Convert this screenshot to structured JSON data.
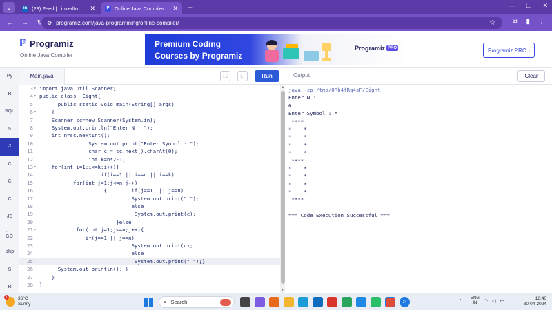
{
  "browser": {
    "tabs": [
      {
        "label": "(23) Feed | LinkedIn",
        "favicon": "in"
      },
      {
        "label": "Online Java Compiler",
        "favicon": "P"
      }
    ],
    "url": "programiz.com/java-programming/online-compiler/"
  },
  "site": {
    "brand": "Programiz",
    "subtitle": "Online Java Compiler",
    "banner": {
      "line1": "Premium Coding",
      "line2": "Courses by Programiz",
      "brand": "Programiz",
      "brand_badge": "PRO"
    },
    "pro_button": "Programiz PRO ›"
  },
  "sidebar": {
    "items": [
      {
        "label": "Py",
        "icon": "python-icon"
      },
      {
        "label": "R",
        "icon": "r-icon"
      },
      {
        "label": "SQL",
        "icon": "database-icon"
      },
      {
        "label": "5",
        "icon": "html-icon"
      },
      {
        "label": "J",
        "icon": "java-icon"
      },
      {
        "label": "C",
        "icon": "c-icon"
      },
      {
        "label": "C",
        "icon": "cpp-icon"
      },
      {
        "label": "C",
        "icon": "csharp-icon"
      },
      {
        "label": "JS",
        "icon": "javascript-icon"
      },
      {
        "label": "-GO",
        "icon": "go-icon"
      },
      {
        "label": "php",
        "icon": "php-icon"
      },
      {
        "label": "S",
        "icon": "swift-icon"
      },
      {
        "label": "R",
        "icon": "rust-icon"
      }
    ],
    "active_index": 4
  },
  "editor": {
    "filename": "Main.java",
    "run_label": "Run",
    "current_line": 25,
    "lines": [
      {
        "n": "3",
        "fold": "▾",
        "code": "import java.util.Scanner;"
      },
      {
        "n": "4",
        "fold": "▾",
        "code": "public class  Eight{"
      },
      {
        "n": "5",
        "fold": "",
        "code": "      public static void main(String[] args)"
      },
      {
        "n": "6",
        "fold": "▾",
        "code": "    {"
      },
      {
        "n": "7",
        "fold": "",
        "code": "    Scanner sc=new Scanner(System.in);"
      },
      {
        "n": "8",
        "fold": "",
        "code": "    System.out.println(\"Enter N : \");"
      },
      {
        "n": "9",
        "fold": "",
        "code": "    int n=sc.nextInt();"
      },
      {
        "n": "10",
        "fold": "",
        "code": "                System.out.print(\"Enter Symbol : \");"
      },
      {
        "n": "11",
        "fold": "",
        "code": "                char c = sc.next().charAt(0);"
      },
      {
        "n": "12",
        "fold": "",
        "code": "                int k=n*2-1;"
      },
      {
        "n": "13",
        "fold": "▾",
        "code": "    for(int i=1;i<=k;i++){"
      },
      {
        "n": "14",
        "fold": "",
        "code": "                    if(i==1 || i==n || i==k)"
      },
      {
        "n": "15",
        "fold": "",
        "code": "           for(int j=1;j<=n;j++)"
      },
      {
        "n": "16",
        "fold": "",
        "code": "                     {        if(j==1  || j==n)"
      },
      {
        "n": "17",
        "fold": "",
        "code": "                              System.out.print(\" \");"
      },
      {
        "n": "18",
        "fold": "",
        "code": "                              else"
      },
      {
        "n": "19",
        "fold": "",
        "code": "                               System.out.print(c);"
      },
      {
        "n": "20",
        "fold": "",
        "code": "                         }else"
      },
      {
        "n": "21",
        "fold": "▾",
        "code": "            for(int j=1;j<=n;j++){"
      },
      {
        "n": "22",
        "fold": "",
        "code": "               if(j==1 || j==n)"
      },
      {
        "n": "23",
        "fold": "",
        "code": "                              System.out.print(c);"
      },
      {
        "n": "24",
        "fold": "",
        "code": "                              else"
      },
      {
        "n": "25",
        "fold": "",
        "code": "                               System.out.print(\" \");}"
      },
      {
        "n": "26",
        "fold": "",
        "code": "      System.out.println(); }"
      },
      {
        "n": "27",
        "fold": "",
        "code": "    }"
      },
      {
        "n": "28",
        "fold": "",
        "code": "}"
      }
    ]
  },
  "output": {
    "title": "Output",
    "clear_label": "Clear",
    "lines": [
      "java -cp /tmp/ORh4fRq4sF/Eight",
      "Enter N :",
      "6",
      "Enter Symbol : *",
      " ****",
      "*    *",
      "*    *",
      "*    *",
      "*    *",
      " ****",
      "*    *",
      "*    *",
      "*    *",
      "*    *",
      " ****",
      "",
      "=== Code Execution Successful ==="
    ]
  },
  "taskbar": {
    "weather_temp": "36°C",
    "weather_desc": "Sunny",
    "weather_badge": "1",
    "search_label": "Search",
    "lang_line1": "ENG",
    "lang_line2": "IN",
    "time": "18:40",
    "date": "30-04-2024",
    "notification_count": "24"
  },
  "colors": {
    "accent": "#2d5bd8",
    "browser_purple": "#7652c9",
    "active_lang": "#2d3bb6"
  }
}
